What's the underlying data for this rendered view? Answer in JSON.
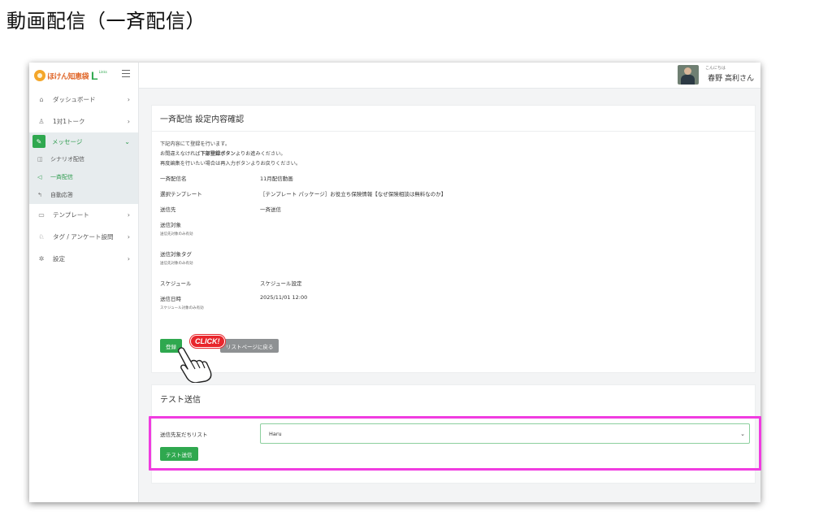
{
  "doc_title": "動画配信（一斉配信）",
  "brand": {
    "name": "ほけん知恵袋",
    "mark": "L",
    "mark_sub": "Links"
  },
  "sidebar": {
    "items": [
      {
        "label": "ダッシュボード",
        "icon": "home-icon"
      },
      {
        "label": "1対1トーク",
        "icon": "user-icon"
      }
    ],
    "group": {
      "label": "メッセージ",
      "icon": "edit-icon",
      "children": [
        {
          "label": "シナリオ配信",
          "icon": "book-icon"
        },
        {
          "label": "一斉配信",
          "icon": "megaphone-icon",
          "current": true
        },
        {
          "label": "自動応答",
          "icon": "reply-icon"
        }
      ]
    },
    "items_after": [
      {
        "label": "テンプレート",
        "icon": "template-icon"
      },
      {
        "label": "タグ / アンケート設問",
        "icon": "tag-icon"
      },
      {
        "label": "設定",
        "icon": "gear-icon"
      }
    ]
  },
  "topbar": {
    "greeting": "こんにちは",
    "user_name": "春野 高利さん"
  },
  "confirm_card": {
    "title": "一斉配信 設定内容確認",
    "intro": [
      "下記内容にて登録を行います。",
      "お間違えなければ下部登録ボタンよりお進みください。",
      "再度編集を行いたい場合は再入力ボタンよりお戻りください。"
    ],
    "intro_bold": "下部登録ボタン",
    "intro_line2_pre": "お間違えなければ",
    "intro_line2_post": "よりお進みください。",
    "rows": [
      {
        "key": "一斉配信名",
        "value": "11月配信動画",
        "note": ""
      },
      {
        "key": "選択テンプレート",
        "value": "［テンプレート パッケージ］お役立ち保険情報【なぜ保険相談は無料なのか】",
        "note": ""
      },
      {
        "key": "送信先",
        "value": "一斉送信",
        "note": ""
      },
      {
        "key": "送信対象",
        "value": "",
        "note": "送信先対象のみ有効"
      },
      {
        "key": "送信対象タグ",
        "value": "",
        "note": "送信先対象のみ有効"
      },
      {
        "key": "スケジュール",
        "value": "スケジュール設定",
        "note": ""
      },
      {
        "key": "送信日時",
        "value": "2025/11/01 12:00",
        "note": "スケジュール対象のみ有効"
      }
    ],
    "register_label": "登録",
    "click_badge": "CLICK!",
    "back_label": "リストページに戻る"
  },
  "test_card": {
    "title": "テスト送信",
    "field_label": "送信先友だちリスト",
    "selected": "Haru",
    "send_label": "テスト送信"
  },
  "colors": {
    "accent": "#2fa84f",
    "highlight": "#f03ce0",
    "badge": "#e8262c"
  }
}
